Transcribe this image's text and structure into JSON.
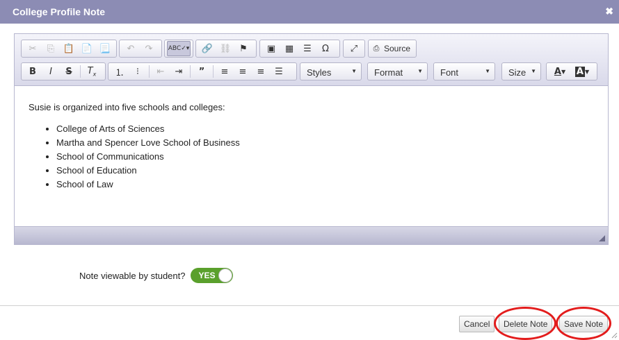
{
  "dialog": {
    "title": "College Profile Note",
    "close_glyph": "✖"
  },
  "toolbar": {
    "row1": [
      "cut-icon",
      "copy-icon",
      "paste-icon",
      "paste-text-icon",
      "paste-word-icon",
      "undo-icon",
      "redo-icon",
      "spellcheck-icon",
      "link-icon",
      "unlink-icon",
      "anchor-flag-icon",
      "image-icon",
      "table-icon",
      "horizontal-rule-icon",
      "special-char-icon",
      "maximize-icon"
    ],
    "source_label": "Source",
    "styles_label": "Styles",
    "format_label": "Format",
    "font_label": "Font",
    "size_label": "Size"
  },
  "content": {
    "intro": "Susie is organized into five schools and colleges:",
    "items": [
      "College of Arts of Sciences",
      "Martha and Spencer Love School of Business",
      "School of Communications",
      "School of Education",
      "School of Law"
    ]
  },
  "visibility": {
    "label": "Note viewable by student?",
    "toggle_text": "YES",
    "value": true
  },
  "footer": {
    "cancel": "Cancel",
    "delete": "Delete Note",
    "save": "Save Note"
  },
  "colors": {
    "titlebar": "#8c8cb4",
    "toggle_on": "#5aa02c",
    "highlight_ring": "#e31c1c"
  }
}
